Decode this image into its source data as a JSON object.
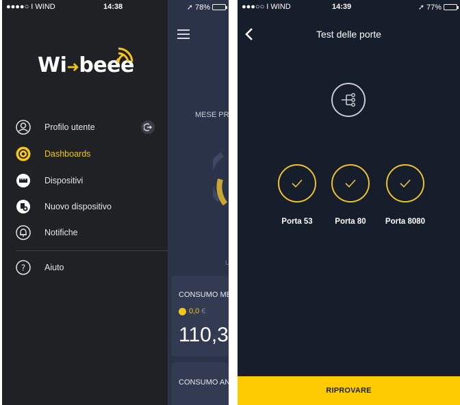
{
  "left_screen": {
    "status_bar": {
      "carrier": "●●●●○ I WIND",
      "time": "14:38",
      "battery": "78%"
    },
    "logo": {
      "text_before": "Wi",
      "text_after": "beee"
    },
    "menu": {
      "items": [
        {
          "label": "Profilo utente",
          "icon": "user-icon"
        },
        {
          "label": "Dashboards",
          "icon": "dashboard-icon",
          "active": true
        },
        {
          "label": "Dispositivi",
          "icon": "device-icon"
        },
        {
          "label": "Nuovo dispositivo",
          "icon": "new-device-icon"
        },
        {
          "label": "Notifiche",
          "icon": "bell-icon"
        },
        {
          "label": "Aiuto",
          "icon": "help-icon"
        }
      ]
    },
    "dashboard_peek": {
      "month_label": "MESE PR",
      "consumo_mese_label": "CONSUMO ME",
      "cost_value": "0,0",
      "cost_unit": "€",
      "big_value": "110,3",
      "consumo_anno_label": "CONSUMO ANI",
      "small_char": "U"
    }
  },
  "right_screen": {
    "status_bar": {
      "carrier": "●●●○○ I WIND",
      "time": "14:39",
      "battery": "77%"
    },
    "title": "Test delle porte",
    "ports": [
      {
        "label": "Porta 53",
        "status": "ok"
      },
      {
        "label": "Porta 80",
        "status": "ok"
      },
      {
        "label": "Porta 8080",
        "status": "ok"
      }
    ],
    "retry_button": "RIPROVARE"
  },
  "colors": {
    "accent": "#fecb00",
    "drawer_bg": "#1f2125",
    "screen_bg": "#161d2b"
  }
}
